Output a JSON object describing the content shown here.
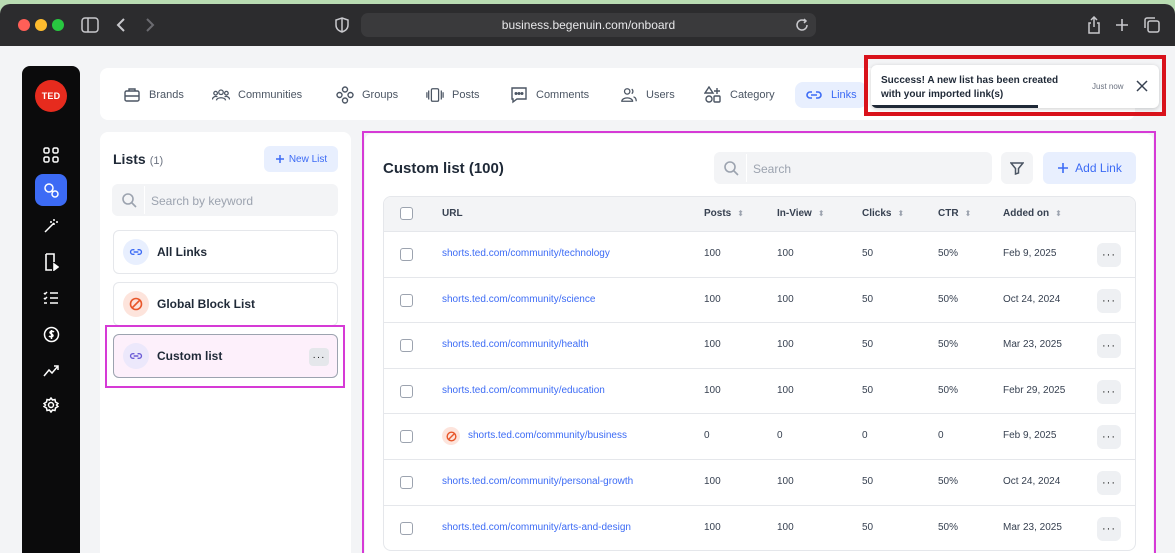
{
  "browser": {
    "url": "business.begenuin.com/onboard"
  },
  "sidebar": {
    "logo_text": "TED",
    "icons": [
      "grid-icon",
      "links-icon",
      "magic-wand-icon",
      "posts-icon",
      "checklist-icon",
      "dollar-icon",
      "analytics-icon",
      "settings-icon"
    ],
    "active_index": 1
  },
  "topnav": {
    "items": [
      {
        "label": "Brands",
        "icon": "briefcase-icon"
      },
      {
        "label": "Communities",
        "icon": "people-icon"
      },
      {
        "label": "Groups",
        "icon": "groups-icon"
      },
      {
        "label": "Posts",
        "icon": "posts-icon"
      },
      {
        "label": "Comments",
        "icon": "comment-icon"
      },
      {
        "label": "Users",
        "icon": "users-icon"
      },
      {
        "label": "Category",
        "icon": "category-icon"
      },
      {
        "label": "Links",
        "icon": "link-icon"
      }
    ],
    "active": "Links"
  },
  "lists": {
    "title": "Lists",
    "count": "(1)",
    "new_list_label": "New List",
    "search_placeholder": "Search by keyword",
    "items": [
      {
        "label": "All Links",
        "icon": "link-icon"
      },
      {
        "label": "Global Block List",
        "icon": "block-icon"
      },
      {
        "label": "Custom list",
        "icon": "link-icon",
        "more": "···"
      }
    ],
    "selected": "Custom list"
  },
  "main": {
    "title": "Custom list (100)",
    "search_placeholder": "Search",
    "add_link_label": "Add Link",
    "columns": [
      "URL",
      "Posts",
      "In-View",
      "Clicks",
      "CTR",
      "Added on"
    ],
    "rows": [
      {
        "url": "shorts.ted.com/community/technology",
        "posts": "100",
        "inview": "100",
        "clicks": "50",
        "ctr": "50%",
        "added": "Feb 9, 2025",
        "blocked": false
      },
      {
        "url": "shorts.ted.com/community/science",
        "posts": "100",
        "inview": "100",
        "clicks": "50",
        "ctr": "50%",
        "added": "Oct 24, 2024",
        "blocked": false
      },
      {
        "url": "shorts.ted.com/community/health",
        "posts": "100",
        "inview": "100",
        "clicks": "50",
        "ctr": "50%",
        "added": "Mar 23, 2025",
        "blocked": false
      },
      {
        "url": "shorts.ted.com/community/education",
        "posts": "100",
        "inview": "100",
        "clicks": "50",
        "ctr": "50%",
        "added": "Febr 29, 2025",
        "blocked": false
      },
      {
        "url": "shorts.ted.com/community/business",
        "posts": "0",
        "inview": "0",
        "clicks": "0",
        "ctr": "0",
        "added": "Feb 9, 2025",
        "blocked": true
      },
      {
        "url": "shorts.ted.com/community/personal-growth",
        "posts": "100",
        "inview": "100",
        "clicks": "50",
        "ctr": "50%",
        "added": "Oct 24, 2024",
        "blocked": false
      },
      {
        "url": "shorts.ted.com/community/arts-and-design",
        "posts": "100",
        "inview": "100",
        "clicks": "50",
        "ctr": "50%",
        "added": "Mar 23, 2025",
        "blocked": false
      }
    ],
    "row_more": "···"
  },
  "toast": {
    "message": "Success! A new list has been created with your imported link(s)",
    "time": "Just now",
    "progress": 0.58
  },
  "colors": {
    "accent": "#3c6bf5",
    "highlight": "#d63ad6",
    "toast_outline": "#d9121b",
    "ted_red": "#e62b1e"
  }
}
